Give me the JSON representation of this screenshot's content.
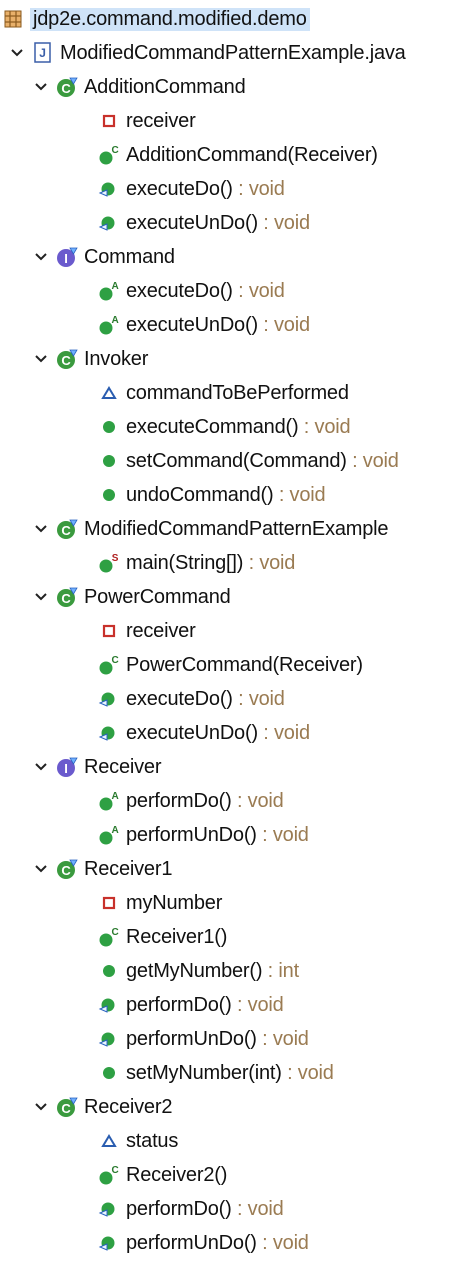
{
  "tree": {
    "package": {
      "label": "jdp2e.command.modified.demo"
    },
    "file": {
      "label": "ModifiedCommandPatternExample.java"
    },
    "types": [
      {
        "name": "AdditionCommand",
        "kind": "class",
        "members": [
          {
            "name": "receiver",
            "type": "",
            "icon": "private-field-icon"
          },
          {
            "name": "AdditionCommand(Receiver)",
            "type": "",
            "icon": "public-constructor-icon"
          },
          {
            "name": "executeDo()",
            "type": "void",
            "icon": "implemented-method-icon"
          },
          {
            "name": "executeUnDo()",
            "type": "void",
            "icon": "implemented-method-icon"
          }
        ]
      },
      {
        "name": "Command",
        "kind": "interface",
        "members": [
          {
            "name": "executeDo()",
            "type": "void",
            "icon": "abstract-method-icon"
          },
          {
            "name": "executeUnDo()",
            "type": "void",
            "icon": "abstract-method-icon"
          }
        ]
      },
      {
        "name": "Invoker",
        "kind": "class",
        "members": [
          {
            "name": "commandToBePerformed",
            "type": "",
            "icon": "default-field-icon"
          },
          {
            "name": "executeCommand()",
            "type": "void",
            "icon": "public-method-icon"
          },
          {
            "name": "setCommand(Command)",
            "type": "void",
            "icon": "public-method-icon"
          },
          {
            "name": "undoCommand()",
            "type": "void",
            "icon": "public-method-icon"
          }
        ]
      },
      {
        "name": "ModifiedCommandPatternExample",
        "kind": "class",
        "members": [
          {
            "name": "main(String[])",
            "type": "void",
            "icon": "static-method-icon"
          }
        ]
      },
      {
        "name": "PowerCommand",
        "kind": "class",
        "members": [
          {
            "name": "receiver",
            "type": "",
            "icon": "private-field-icon"
          },
          {
            "name": "PowerCommand(Receiver)",
            "type": "",
            "icon": "public-constructor-icon"
          },
          {
            "name": "executeDo()",
            "type": "void",
            "icon": "implemented-method-icon"
          },
          {
            "name": "executeUnDo()",
            "type": "void",
            "icon": "implemented-method-icon"
          }
        ]
      },
      {
        "name": "Receiver",
        "kind": "interface",
        "members": [
          {
            "name": "performDo()",
            "type": "void",
            "icon": "abstract-method-icon"
          },
          {
            "name": "performUnDo()",
            "type": "void",
            "icon": "abstract-method-icon"
          }
        ]
      },
      {
        "name": "Receiver1",
        "kind": "class",
        "members": [
          {
            "name": "myNumber",
            "type": "",
            "icon": "private-field-icon"
          },
          {
            "name": "Receiver1()",
            "type": "",
            "icon": "public-constructor-icon"
          },
          {
            "name": "getMyNumber()",
            "type": "int",
            "icon": "public-method-icon"
          },
          {
            "name": "performDo()",
            "type": "void",
            "icon": "implemented-method-icon"
          },
          {
            "name": "performUnDo()",
            "type": "void",
            "icon": "implemented-method-icon"
          },
          {
            "name": "setMyNumber(int)",
            "type": "void",
            "icon": "public-method-icon"
          }
        ]
      },
      {
        "name": "Receiver2",
        "kind": "class",
        "members": [
          {
            "name": "status",
            "type": "",
            "icon": "default-field-icon"
          },
          {
            "name": "Receiver2()",
            "type": "",
            "icon": "public-constructor-icon"
          },
          {
            "name": "performDo()",
            "type": "void",
            "icon": "implemented-method-icon"
          },
          {
            "name": "performUnDo()",
            "type": "void",
            "icon": "implemented-method-icon"
          }
        ]
      }
    ],
    "type_separator": " : "
  },
  "colors": {
    "class_icon": "#3a9a3e",
    "interface_icon": "#6a5acd",
    "method_icon": "#2ea043",
    "private_field": "#c8312b",
    "default_field": "#2a5db0",
    "return_type": "#9a7b52",
    "selection": "#cfe3f8"
  }
}
